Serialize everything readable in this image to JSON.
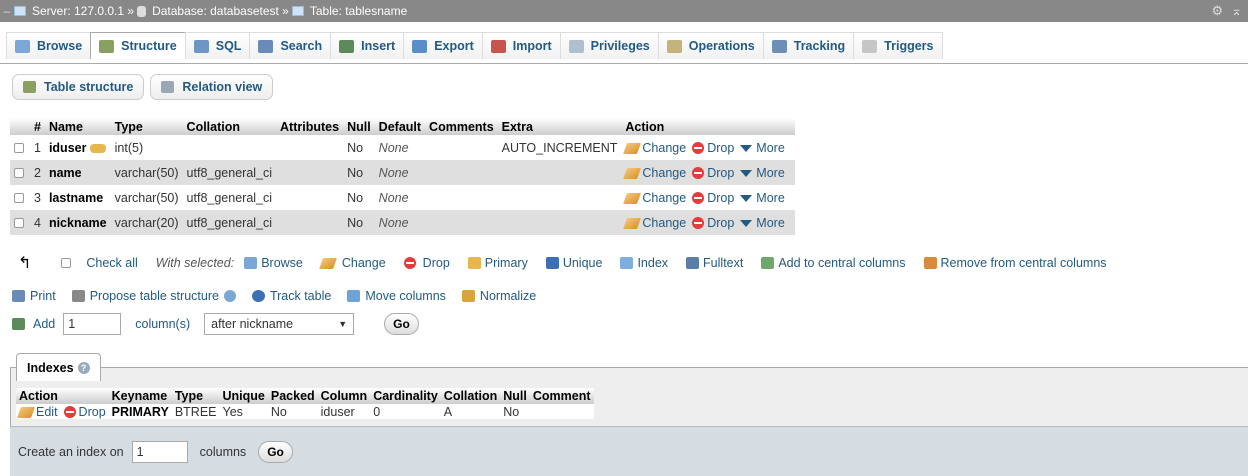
{
  "breadcrumb": {
    "server": "Server: 127.0.0.1 »",
    "database": "Database: databasetest »",
    "table": "Table: tablesname"
  },
  "tabs": [
    {
      "label": "Browse",
      "icon": "browse-icon",
      "color": "#7aa7d6"
    },
    {
      "label": "Structure",
      "icon": "structure-icon",
      "color": "#8aa060"
    },
    {
      "label": "SQL",
      "icon": "sql-icon",
      "color": "#6d96c4"
    },
    {
      "label": "Search",
      "icon": "search-icon",
      "color": "#6a8bb8"
    },
    {
      "label": "Insert",
      "icon": "insert-icon",
      "color": "#5d8a5a"
    },
    {
      "label": "Export",
      "icon": "export-icon",
      "color": "#5b8ec9"
    },
    {
      "label": "Import",
      "icon": "import-icon",
      "color": "#c9534f"
    },
    {
      "label": "Privileges",
      "icon": "privileges-icon",
      "color": "#b0bfcf"
    },
    {
      "label": "Operations",
      "icon": "operations-icon",
      "color": "#c4b37a"
    },
    {
      "label": "Tracking",
      "icon": "tracking-icon",
      "color": "#6d8fb6"
    },
    {
      "label": "Triggers",
      "icon": "triggers-icon",
      "color": "#c6c6c6"
    }
  ],
  "subtabs": {
    "structure": "Table structure",
    "relation": "Relation view"
  },
  "columns_table": {
    "headers": [
      "#",
      "Name",
      "Type",
      "Collation",
      "Attributes",
      "Null",
      "Default",
      "Comments",
      "Extra",
      "Action"
    ],
    "rows": [
      {
        "num": "1",
        "name": "iduser",
        "type": "int(5)",
        "collation": "",
        "null": "No",
        "default": "None",
        "extra": "AUTO_INCREMENT"
      },
      {
        "num": "2",
        "name": "name",
        "type": "varchar(50)",
        "collation": "utf8_general_ci",
        "null": "No",
        "default": "None",
        "extra": ""
      },
      {
        "num": "3",
        "name": "lastname",
        "type": "varchar(50)",
        "collation": "utf8_general_ci",
        "null": "No",
        "default": "None",
        "extra": ""
      },
      {
        "num": "4",
        "name": "nickname",
        "type": "varchar(20)",
        "collation": "utf8_general_ci",
        "null": "No",
        "default": "None",
        "extra": ""
      }
    ],
    "actions": {
      "change": "Change",
      "drop": "Drop",
      "more": "More"
    }
  },
  "with_selected": {
    "check_all": "Check all",
    "label": "With selected:",
    "items": [
      "Browse",
      "Change",
      "Drop",
      "Primary",
      "Unique",
      "Index",
      "Fulltext",
      "Add to central columns",
      "Remove from central columns"
    ]
  },
  "actions_row": [
    "Print",
    "Propose table structure",
    "Track table",
    "Move columns",
    "Normalize"
  ],
  "add_row": {
    "add": "Add",
    "count": "1",
    "unit": "column(s)",
    "position": "after nickname",
    "go": "Go"
  },
  "indexes": {
    "title": "Indexes",
    "headers": [
      "Action",
      "Keyname",
      "Type",
      "Unique",
      "Packed",
      "Column",
      "Cardinality",
      "Collation",
      "Null",
      "Comment"
    ],
    "row": {
      "edit": "Edit",
      "drop": "Drop",
      "keyname": "PRIMARY",
      "type": "BTREE",
      "unique": "Yes",
      "packed": "No",
      "column": "iduser",
      "cardinality": "0",
      "collation": "A",
      "null": "No",
      "comment": ""
    },
    "create_label": "Create an index on",
    "create_count": "1",
    "create_unit": "columns",
    "go": "Go"
  }
}
